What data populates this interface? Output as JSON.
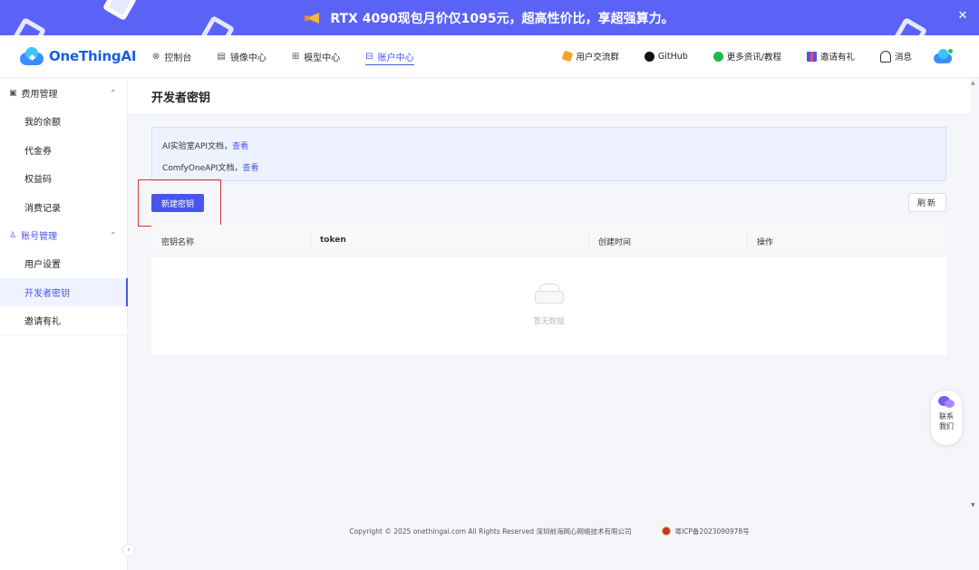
{
  "banner": {
    "text": "RTX 4090现包月价仅1095元，超高性价比，享超强算力。",
    "close": "✕"
  },
  "header": {
    "logo_text": "OneThingAI",
    "nav": [
      {
        "label": "控制台",
        "icon": "⊗"
      },
      {
        "label": "镜像中心",
        "icon": "▤"
      },
      {
        "label": "模型中心",
        "icon": "⊞"
      },
      {
        "label": "账户中心",
        "icon": "⊟"
      }
    ],
    "right": {
      "user_group": "用户交流群",
      "github": "GitHub",
      "more_info": "更多资讯/教程",
      "invite": "邀请有礼",
      "messages": "消息"
    }
  },
  "sidebar": {
    "group_billing": "费用管理",
    "billing_items": [
      "我的余额",
      "代金券",
      "权益码",
      "消费记录"
    ],
    "group_account": "账号管理",
    "account_items": [
      "用户设置",
      "开发者密钥",
      "邀请有礼"
    ],
    "collapse": "‹",
    "billing_icon": "▣",
    "account_icon": "♙",
    "chevron": "⌃"
  },
  "main": {
    "title": "开发者密钥",
    "info": {
      "line1_text": "AI实验室API文档，",
      "line1_link": "查看",
      "line2_text": "ComfyOneAPI文档，",
      "line2_link": "查看"
    },
    "new_key_button": "新建密钥",
    "refresh_button": "刷新",
    "table": {
      "columns": [
        "密钥名称",
        "token",
        "创建时间",
        "操作"
      ],
      "empty_text": "暂无数据"
    }
  },
  "contact": {
    "line1": "联系",
    "line2": "我们"
  },
  "footer": {
    "copyright": "Copyright © 2025 onethingai.com All Rights Reserved 深圳前海网心网络技术有限公司",
    "icp": "粤ICP备2023090978号"
  },
  "scroll": {
    "up": "▲",
    "down": "▼"
  },
  "colors": {
    "banner": "#5b63f6",
    "accent": "#4a55f0",
    "highlight": "#e23131"
  }
}
